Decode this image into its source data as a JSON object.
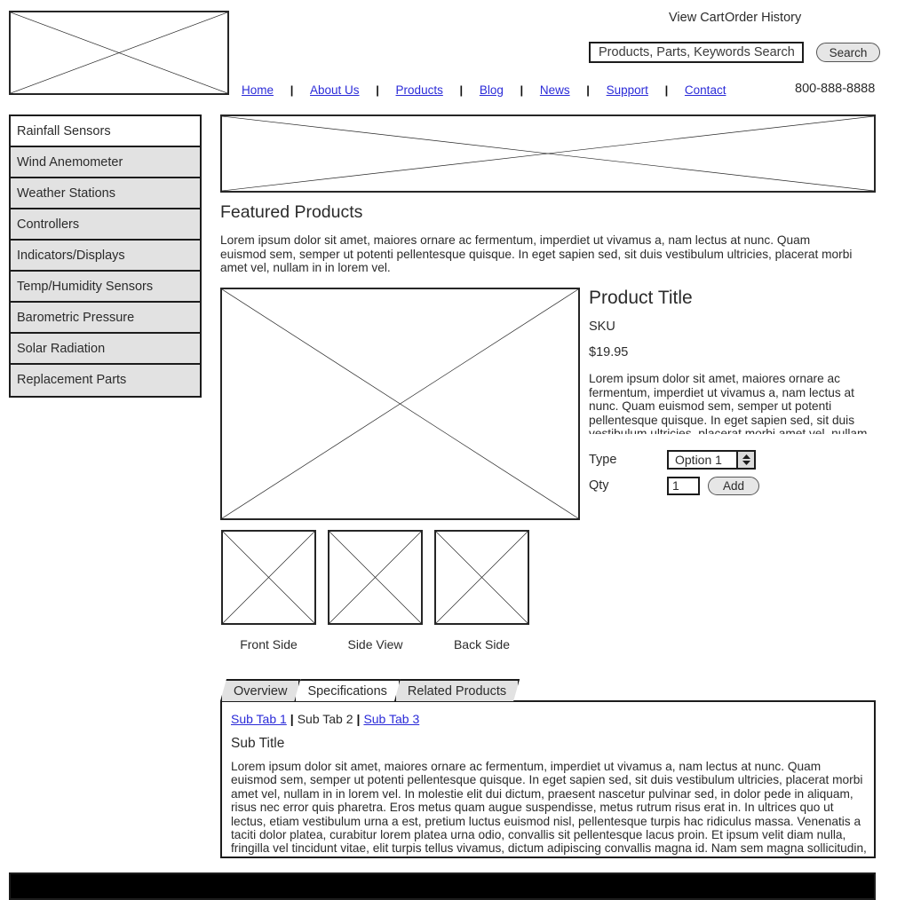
{
  "header": {
    "logo_alt": "Company Logo",
    "view_cart": "View Cart",
    "order_history": "Order History",
    "search_placeholder": "Products, Parts, Keywords Search",
    "search_value": "",
    "search_button": "Search",
    "phone": "800-888-8888",
    "nav": [
      {
        "label": "Home"
      },
      {
        "label": "About Us"
      },
      {
        "label": "Products"
      },
      {
        "label": "Blog"
      },
      {
        "label": "News"
      },
      {
        "label": "Support"
      },
      {
        "label": "Contact"
      }
    ],
    "nav_separator": "|"
  },
  "sidebar": {
    "items": [
      {
        "label": "Rainfall Sensors",
        "selected": true
      },
      {
        "label": "Wind Anemometer",
        "selected": false
      },
      {
        "label": "Weather Stations",
        "selected": false
      },
      {
        "label": "Controllers",
        "selected": false
      },
      {
        "label": "Indicators/Displays",
        "selected": false
      },
      {
        "label": "Temp/Humidity Sensors",
        "selected": false
      },
      {
        "label": "Barometric Pressure",
        "selected": false
      },
      {
        "label": "Solar Radiation",
        "selected": false
      },
      {
        "label": "Replacement Parts",
        "selected": false
      }
    ]
  },
  "main": {
    "banner_alt": "Banner Image",
    "featured_title": "Featured Products",
    "featured_body": "Lorem ipsum dolor sit amet, maiores ornare ac fermentum, imperdiet ut vivamus a, nam lectus at nunc. Quam euismod sem, semper ut potenti pellentesque quisque. In eget sapien sed, sit duis vestibulum ultricies, placerat morbi amet vel, nullam in in lorem vel."
  },
  "product": {
    "image_alt": "Product Image",
    "title": "Product Title",
    "sku": "SKU",
    "price": "$19.95",
    "description": "Lorem ipsum dolor sit amet, maiores ornare ac fermentum, imperdiet ut vivamus a, nam lectus at nunc. Quam euismod sem, semper ut potenti pellentesque quisque. In eget sapien sed, sit duis vestibulum ultricies, placerat morbi amet vel, nullam in in lorem vel. In molestie elit dui dictum, praesent nascetur pulvinar sed.",
    "type_label": "Type",
    "type_value": "Option 1",
    "type_options": [
      "Option 1"
    ],
    "qty_label": "Qty",
    "qty_value": "1",
    "add_button": "Add",
    "thumbnails": [
      {
        "caption": "Front Side",
        "alt": "Front Side Thumbnail"
      },
      {
        "caption": "Side View",
        "alt": "Side View Thumbnail"
      },
      {
        "caption": "Back Side",
        "alt": "Back Side Thumbnail"
      }
    ]
  },
  "tabs": {
    "items": [
      {
        "label": "Overview",
        "active": false
      },
      {
        "label": "Specifications",
        "active": true
      },
      {
        "label": "Related Products",
        "active": false
      }
    ],
    "subtabs": [
      {
        "label": "Sub Tab 1",
        "link": true
      },
      {
        "label": "Sub Tab 2",
        "link": false
      },
      {
        "label": "Sub Tab 3",
        "link": true
      }
    ],
    "subtab_separator": "|",
    "sub_title": "Sub Title",
    "body": "Lorem ipsum dolor sit amet, maiores ornare ac fermentum, imperdiet ut vivamus a, nam lectus at nunc. Quam euismod sem, semper ut potenti pellentesque quisque. In eget sapien sed, sit duis vestibulum ultricies, placerat morbi amet vel, nullam in in lorem vel. In molestie elit dui dictum, praesent nascetur pulvinar sed, in dolor pede in aliquam, risus nec error quis pharetra. Eros metus quam augue suspendisse, metus rutrum risus erat in.  In ultrices quo ut lectus, etiam vestibulum urna a est, pretium luctus euismod nisl, pellentesque turpis hac ridiculus massa. Venenatis a taciti dolor platea, curabitur lorem platea urna odio, convallis sit pellentesque lacus proin. Et ipsum velit diam nulla, fringilla vel tincidunt vitae, elit turpis tellus vivamus, dictum adipiscing convallis magna id. Nam sem magna sollicitudin, habitant sed quis amet, sollicitudin blandit fusce turpis adipiscing amet."
  },
  "footer": {
    "alt": "Footer Bar"
  },
  "colors": {
    "link": "#2b2bd8",
    "line": "#1c1c1c",
    "panel_gray": "#e2e2e2",
    "button_gray": "#e6e6e6",
    "footer": "#000000"
  }
}
